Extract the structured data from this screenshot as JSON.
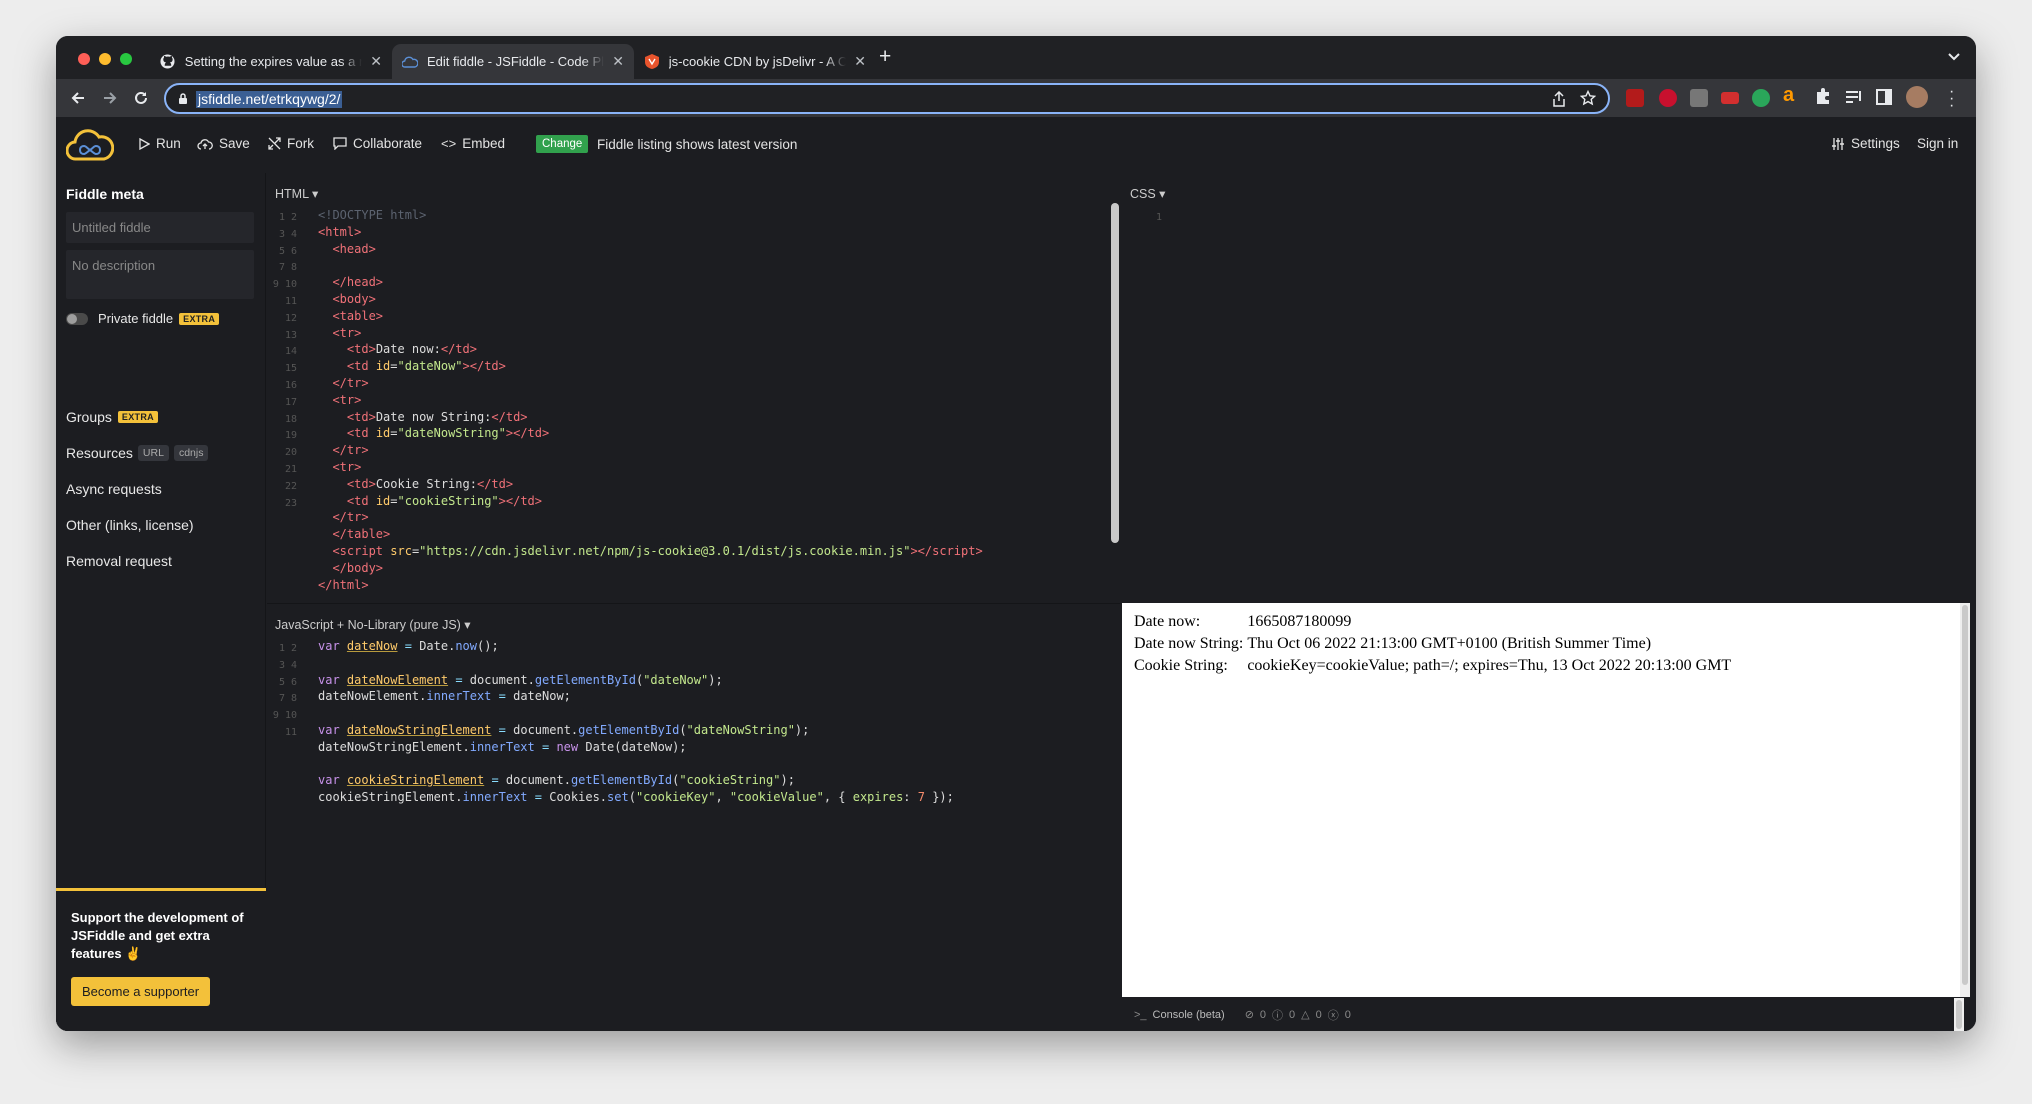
{
  "browser": {
    "tabs": [
      {
        "title": "Setting the expires value as a n",
        "icon": "github-icon"
      },
      {
        "title": "Edit fiddle - JSFiddle - Code Pl",
        "icon": "jsfiddle-icon"
      },
      {
        "title": "js-cookie CDN by jsDelivr - A C",
        "icon": "jsdelivr-icon"
      }
    ],
    "url": "jsfiddle.net/etrkqywg/2/"
  },
  "header": {
    "run": "Run",
    "save": "Save",
    "fork": "Fork",
    "collaborate": "Collaborate",
    "embed": "Embed",
    "change_badge": "Change",
    "listing_text": "Fiddle listing shows latest version",
    "settings": "Settings",
    "sign_in": "Sign in"
  },
  "sidebar": {
    "title": "Fiddle meta",
    "title_placeholder": "Untitled fiddle",
    "description_placeholder": "No description",
    "private_label": "Private fiddle",
    "extra_badge": "EXTRA",
    "groups": "Groups",
    "resources": "Resources",
    "resources_tags": [
      "URL",
      "cdnjs"
    ],
    "async": "Async requests",
    "other": "Other (links, license)",
    "removal": "Removal request",
    "support_text": "Support the development of JSFiddle and get extra features ✌️",
    "support_button": "Become a supporter"
  },
  "panes": {
    "html_label": "HTML ▾",
    "css_label": "CSS ▾",
    "js_label": "JavaScript + No-Library (pure JS) ▾"
  },
  "result": {
    "rows": [
      {
        "label": "Date now:",
        "value": "1665087180099"
      },
      {
        "label": "Date now String:",
        "value": "Thu Oct 06 2022 21:13:00 GMT+0100 (British Summer Time)"
      },
      {
        "label": "Cookie String:",
        "value": "cookieKey=cookieValue; path=/; expires=Thu, 13 Oct 2022 20:13:00 GMT"
      }
    ]
  },
  "console": {
    "label": "Console (beta)",
    "counts": [
      "0",
      "0",
      "0",
      "0"
    ]
  },
  "colors": {
    "accent": "#f3c13a",
    "change": "#31a14d",
    "focus": "#8ab4f8"
  }
}
